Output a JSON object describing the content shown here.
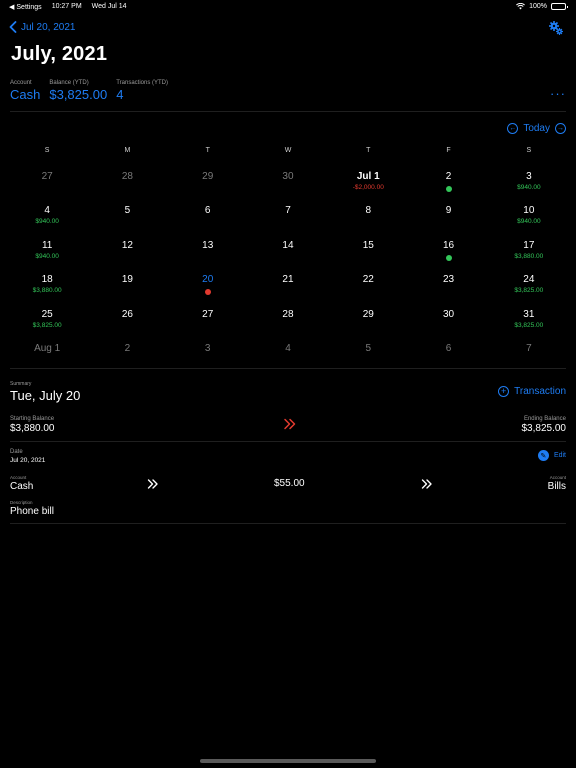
{
  "status_bar": {
    "back_app": "Settings",
    "time": "10:27 PM",
    "date": "Wed Jul 14",
    "battery": "100%"
  },
  "nav": {
    "back_label": "Jul 20, 2021",
    "title": "July, 2021"
  },
  "stats": [
    {
      "label": "Account",
      "value": "Cash"
    },
    {
      "label": "Balance (YTD)",
      "value": "$3,825.00"
    },
    {
      "label": "Transactions (YTD)",
      "value": "4"
    }
  ],
  "more_label": "···",
  "calendar": {
    "today_label": "Today",
    "weekdays": [
      "S",
      "M",
      "T",
      "W",
      "T",
      "F",
      "S"
    ],
    "weeks": [
      [
        {
          "num": "27",
          "muted": true
        },
        {
          "num": "28",
          "muted": true
        },
        {
          "num": "29",
          "muted": true
        },
        {
          "num": "30",
          "muted": true
        },
        {
          "num": "Jul 1",
          "bold": true,
          "amount": "-$2,000.00",
          "negative": true
        },
        {
          "num": "2",
          "dot": "green"
        },
        {
          "num": "3",
          "amount": "$940.00"
        }
      ],
      [
        {
          "num": "4",
          "amount": "$940.00"
        },
        {
          "num": "5"
        },
        {
          "num": "6"
        },
        {
          "num": "7"
        },
        {
          "num": "8"
        },
        {
          "num": "9"
        },
        {
          "num": "10",
          "amount": "$940.00"
        }
      ],
      [
        {
          "num": "11",
          "amount": "$940.00"
        },
        {
          "num": "12"
        },
        {
          "num": "13"
        },
        {
          "num": "14"
        },
        {
          "num": "15"
        },
        {
          "num": "16",
          "dot": "green"
        },
        {
          "num": "17",
          "amount": "$3,880.00"
        }
      ],
      [
        {
          "num": "18",
          "amount": "$3,880.00"
        },
        {
          "num": "19"
        },
        {
          "num": "20",
          "today": true,
          "dot": "red"
        },
        {
          "num": "21"
        },
        {
          "num": "22"
        },
        {
          "num": "23"
        },
        {
          "num": "24",
          "amount": "$3,825.00"
        }
      ],
      [
        {
          "num": "25",
          "amount": "$3,825.00"
        },
        {
          "num": "26"
        },
        {
          "num": "27"
        },
        {
          "num": "28"
        },
        {
          "num": "29"
        },
        {
          "num": "30"
        },
        {
          "num": "31",
          "amount": "$3,825.00"
        }
      ],
      [
        {
          "num": "Aug 1",
          "muted": true
        },
        {
          "num": "2",
          "muted": true
        },
        {
          "num": "3",
          "muted": true
        },
        {
          "num": "4",
          "muted": true
        },
        {
          "num": "5",
          "muted": true
        },
        {
          "num": "6",
          "muted": true
        },
        {
          "num": "7",
          "muted": true
        }
      ]
    ]
  },
  "summary": {
    "label": "Summary",
    "date": "Tue, July 20",
    "add_label": "Transaction",
    "starting_label": "Starting Balance",
    "starting_value": "$3,880.00",
    "ending_label": "Ending Balance",
    "ending_value": "$3,825.00"
  },
  "transaction": {
    "date_label": "Date",
    "date_value": "Jul 20, 2021",
    "edit_label": "Edit",
    "from_label": "Account",
    "from_value": "Cash",
    "amount": "$55.00",
    "to_label": "Account",
    "to_value": "Bills",
    "desc_label": "Description",
    "desc_value": "Phone bill"
  },
  "colors": {
    "accent": "#1e7cf2",
    "positive": "#33c659",
    "negative": "#e23a2f",
    "background": "#000000"
  }
}
